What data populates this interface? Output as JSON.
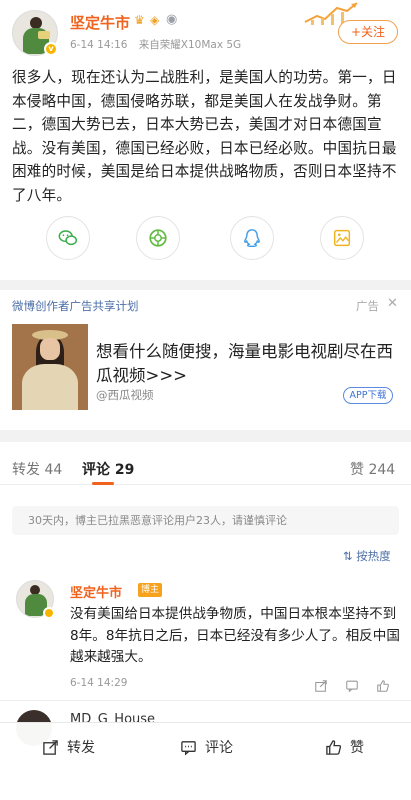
{
  "post": {
    "username": "坚定牛市",
    "time": "6-14 14:16",
    "source": "来自荣耀X10Max 5G",
    "follow_label": "+关注",
    "text": "很多人，现在还认为二战胜利，是美国人的功劳。第一，日本侵略中国，德国侵略苏联，都是美国人在发战争财。第二，德国大势已去，日本大势已去，美国才对日本德国宣战。没有美国，德国已经必败，日本已经必败。中国抗日最困难的时候，美国是给日本提供战略物质，否则日本坚持不了八年。",
    "share_icons": [
      "wechat-icon",
      "moments-icon",
      "qq-icon",
      "qzone-icon"
    ]
  },
  "ad": {
    "header": "微博创作者广告共享计划",
    "tag": "广告",
    "close": "✕",
    "title": "想看什么随便搜，海量电影电视剧尽在西瓜视频>>>",
    "source": "@西瓜视频",
    "button": "APP下载"
  },
  "tabs": {
    "repost": "转发 44",
    "comment": "评论 29",
    "like": "赞 244"
  },
  "notice": "30天内，博主已拉黑恶意评论用户23人，请谨慎评论",
  "sort_label": "按热度",
  "comment": {
    "username": "坚定牛市",
    "tag": "博主",
    "text": "没有美国给日本提供战争物质，中国日本根本坚持不到8年。8年抗日之后，日本已经没有多少人了。相反中国越来越强大。",
    "time": "6-14 14:29"
  },
  "next_comment": {
    "username": "MD_G_House"
  },
  "bottom_bar": {
    "repost": "转发",
    "comment": "评论",
    "like": "赞"
  },
  "colors": {
    "accent": "#f0621d",
    "link": "#4d6fa8",
    "badge": "#f7b500"
  }
}
